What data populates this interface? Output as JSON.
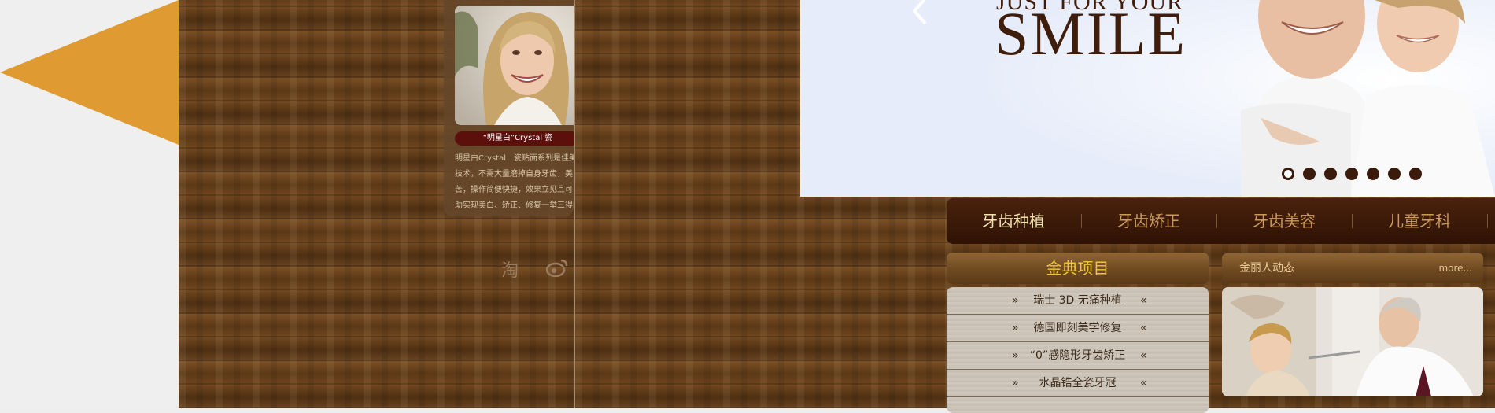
{
  "card": {
    "title": "“明星白”Crystal 瓷",
    "text_lines": [
      "明星白Crystal　瓷贴面系列是佳美",
      "技术，不需大量磨掉自身牙齿，美",
      "苦，操作简便快捷，效果立见且可",
      "助实现美白、矫正、修复一举三得的"
    ]
  },
  "social": {
    "taobao_glyph": "淘",
    "weibo_icon": "weibo-icon"
  },
  "banner": {
    "line_small": "JUST FOR YOUR",
    "line_big": "SMILE",
    "dots": [
      {
        "active": true
      },
      {
        "active": false
      },
      {
        "active": false
      },
      {
        "active": false
      },
      {
        "active": false
      },
      {
        "active": false
      },
      {
        "active": false
      }
    ]
  },
  "nav": {
    "items": [
      {
        "label": "牙齿种植",
        "active": true
      },
      {
        "label": "牙齿矫正",
        "active": false
      },
      {
        "label": "牙齿美容",
        "active": false
      },
      {
        "label": "儿童牙科",
        "active": false
      }
    ]
  },
  "classic": {
    "title": "金典项目",
    "items": [
      "瑞士 3D 无痛种植",
      "德国即刻美学修复",
      "“0”感隐形牙齿矫正",
      "水晶锆全瓷牙冠"
    ],
    "quote_left": "»",
    "quote_right": "«"
  },
  "news": {
    "title": "金丽人动态",
    "more": "more..."
  },
  "colors": {
    "accent_orange": "#df9a32",
    "wood_dark": "#4a2a10",
    "nav_active_text": "#f2e3b0",
    "nav_text": "#c99a5a",
    "gold_title": "#f0c53b",
    "banner_bg": "#e6ecf9",
    "brand_brown": "#3f1d0c"
  }
}
